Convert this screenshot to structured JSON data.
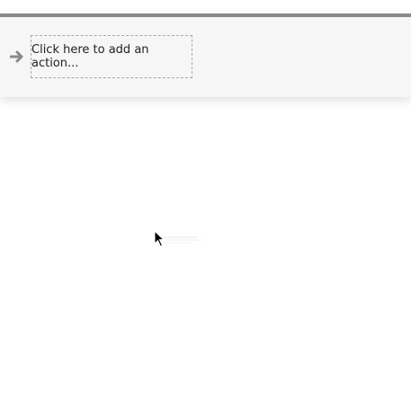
{
  "action_panel": {
    "add_action_label": "Click here to add an action..."
  },
  "icons": {
    "arrow": "arrow-right-icon",
    "cursor": "mouse-pointer-icon"
  },
  "colors": {
    "panel_background": "#f6f6f6",
    "panel_border": "#8a8a8a",
    "arrow": "#8a8a8a",
    "dashed_border": "#a8a8a8"
  }
}
